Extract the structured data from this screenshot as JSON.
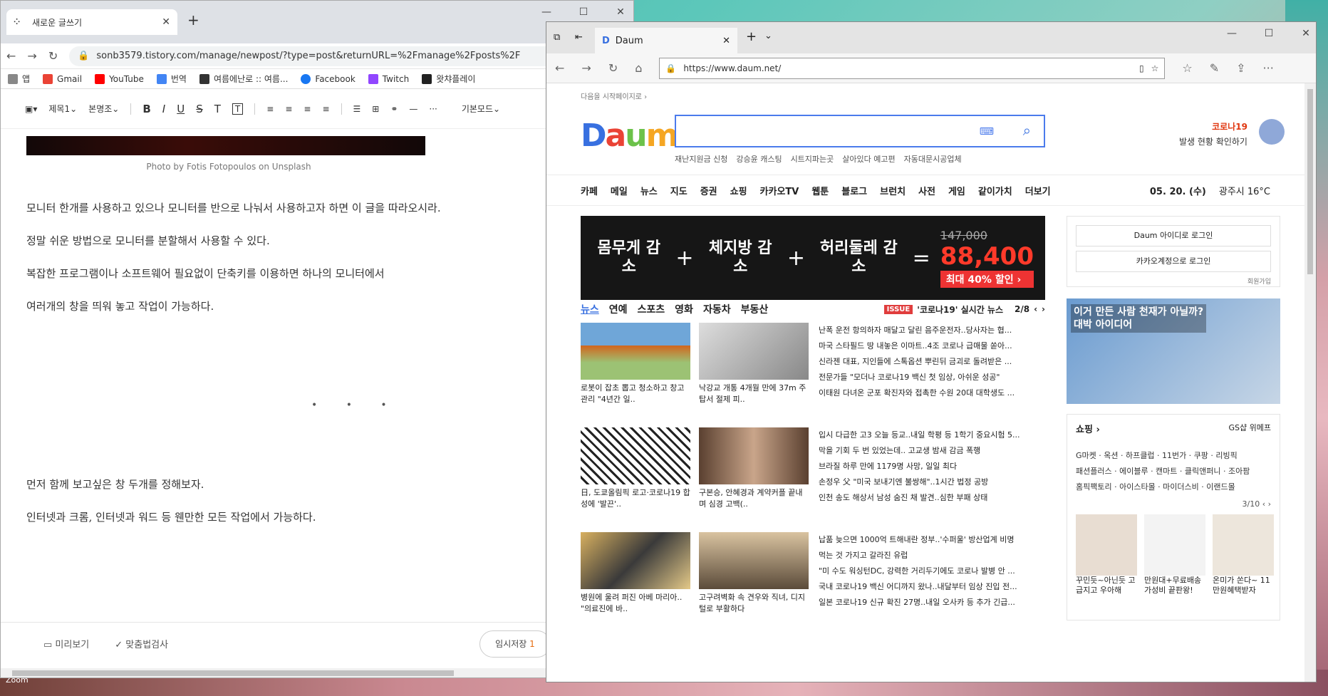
{
  "chrome": {
    "tab_title": "새로운 글쓰기",
    "url": "sonb3579.tistory.com/manage/newpost/?type=post&returnURL=%2Fmanage%2Fposts%2F",
    "bookmarks": [
      "앱",
      "Gmail",
      "YouTube",
      "번역",
      "여름에난로 :: 여름...",
      "Facebook",
      "Twitch",
      "왓챠플레이"
    ],
    "toolbar": {
      "heading": "제목1",
      "font": "본명조",
      "mode": "기본모드"
    },
    "caption": "Photo by  Fotis Fotopoulos  on  Unsplash",
    "paragraphs": [
      "모니터 한개를 사용하고 있으나 모니터를 반으로 나눠서 사용하고자 하면 이 글을 따라오시라.",
      "정말 쉬운 방법으로 모니터를 분할해서 사용할 수 있다.",
      "복잡한 프로그램이나 소프트웨어 필요없이 단축키를 이용하면 하나의 모니터에서",
      "여러개의 창을 띄워 놓고 작업이 가능하다.",
      "먼저 함께 보고싶은 창 두개를 정해보자.",
      "인터넷과 크롬, 인터넷과 워드 등 웬만한 모든 작업에서 가능하다."
    ],
    "dots": "• • •",
    "bottom": {
      "preview": "미리보기",
      "spellcheck": "맞춤법검사",
      "save": "임시저장",
      "save_count": "1"
    }
  },
  "desktop": {
    "zoom_label": "Zoom"
  },
  "edge": {
    "tab_title": "Daum",
    "url": "https://www.daum.net/",
    "start_page": "다음을 시작페이지로 ›",
    "logo": "Daum",
    "related": [
      "재난지원금 신청",
      "강승윤 캐스팅",
      "시트지파는곳",
      "살아있다 예고편",
      "자동대문시공업체"
    ],
    "corona": {
      "title": "코로나19",
      "sub": "발생 현황 확인하기"
    },
    "gnb": [
      "카페",
      "메일",
      "뉴스",
      "지도",
      "증권",
      "쇼핑",
      "카카오TV",
      "웹툰",
      "블로그",
      "브런치",
      "사전",
      "게임",
      "같이가치",
      "더보기"
    ],
    "date": "05. 20. (수)",
    "weather": "광주시  16°C",
    "banner": {
      "w1": "몸무게 감소",
      "w2": "체지방 감소",
      "w3": "허리둘레 감소",
      "old": "147,000",
      "price": "88,400",
      "sale": "최대 40% 할인 ›"
    },
    "news_tabs": [
      "뉴스",
      "연예",
      "스포츠",
      "영화",
      "자동차",
      "부동산"
    ],
    "issue": {
      "tag": "ISSUE",
      "text": "'코로나19' 실시간 뉴스",
      "page": "2/8"
    },
    "rows": [
      {
        "caps": [
          "로봇이 잡초 뽑고 청소하고 창고관리 \"4년간 일..",
          "낙강교 개통 4개월 만에 37m 주탑서 절제 피.."
        ],
        "heads": [
          "난폭 운전 항의하자 매달고 달린 음주운전자..당사자는 협...",
          "마국 스타필드 땅 내놓은 이마트..4조 코로나 급매물 쏟아...",
          "신라젠 대표, 지인들에 스톡옵션 뿌린뒤 금괴로 돌려받은 ...",
          "전문가들 \"모더나 코로나19 백신 첫 임상, 아쉬운 성공\"",
          "이태원 다녀온 군포 확진자와 접촉한 수원 20대 대학생도 ..."
        ]
      },
      {
        "caps": [
          "日, 도쿄올림픽 로고·코로나19 합성에 '발끈'..",
          "구본승, 안혜경과 계약커플 끝내며 심경 고백(.."
        ],
        "heads": [
          "입시 다급한 고3 오늘 등교..내일 학평 등 1학기 중요시험 5...",
          "막을 기회 두 번 있었는데.. 고교생 밤새 감금 폭행",
          "브라질 하루 만에 1179명 사망, 일일 최다",
          "손정우 父 \"미국 보내기엔 불쌍해\"..1시간 법정 공방",
          "인천 송도 해상서 남성 숨진 채 발견..심한 부패 상태"
        ]
      },
      {
        "caps": [
          "병원에 울려 퍼진 아베 마리아.. \"의료진에 바..",
          "고구려벽화 속 견우와 직녀, 디지털로 부활하다"
        ],
        "heads": [
          "납품 늦으면 1000억 트해내란 정부..'수퍼울' 방산업계 비명",
          "먹는 것 가지고 갈라진 유럽",
          "\"미 수도 워싱턴DC, 강력한 거리두기에도 코로나 발병 안 ...",
          "국내 코로나19 백신 어디까지 왔나..내달부터 임상 진입 전...",
          "일본 코로나19 신규 확진 27명..내일 오사카 등 추가 긴급..."
        ]
      }
    ],
    "login": {
      "daum": "Daum 아이디로 로그인",
      "kakao": "카카오계정으로 로그인",
      "join": "회원가입"
    },
    "ad_text": "이거 만든 사람 천재가 아닐까?\n대박 아이디어",
    "shop": {
      "title": "쇼핑 ›",
      "partners": "GS샵   위메프",
      "links": [
        "G마켓 · 옥션 · 하프클럽 · 11번가 · 쿠팡 · 리빙픽",
        "패션플러스 · 에이블루 · 캔마트 · 클릭앤퍼니 · 조아팜",
        "홈픽팩토리 · 아이스타몰 · 마이더스비 · 이랜드몰"
      ],
      "pager": "3/10",
      "products": [
        "꾸민듯~아닌듯 고급지고 우아해",
        "만원대+무료배송 가성비 끝판왕!",
        "온미가 쏜다~ 11만원혜택받자"
      ]
    }
  }
}
